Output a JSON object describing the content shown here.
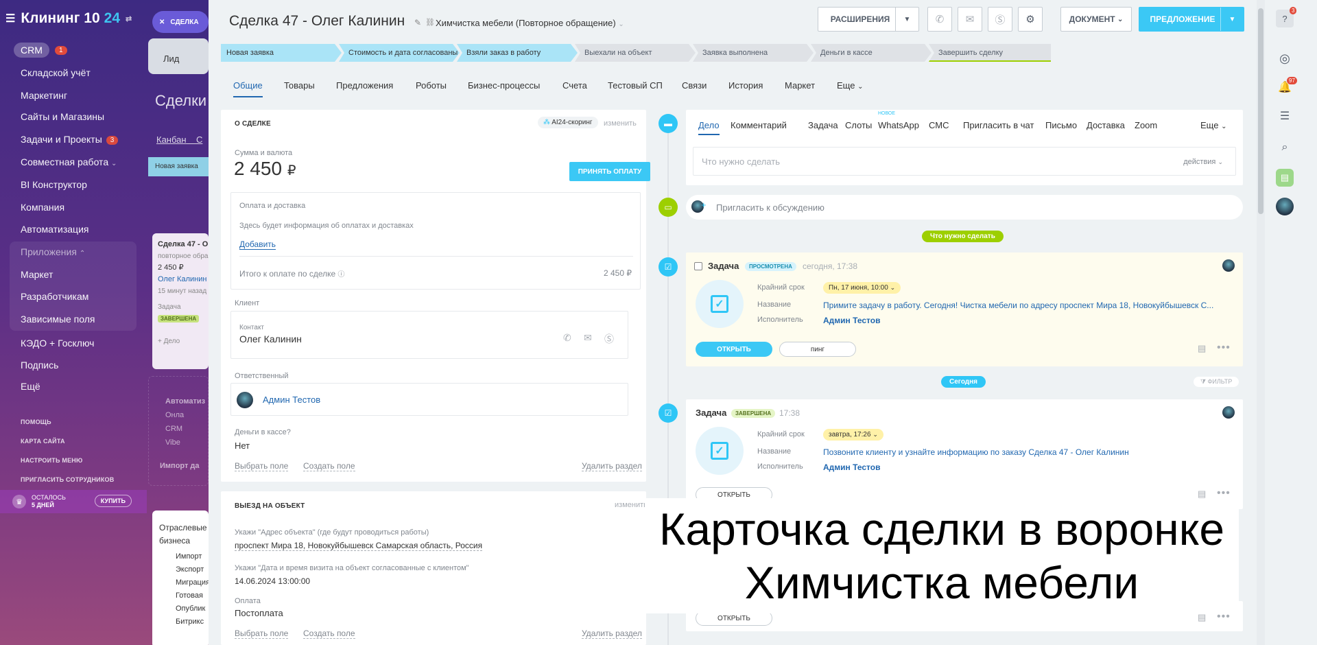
{
  "sidebar": {
    "logo_text": "Клининг 10",
    "logo_accent": "24",
    "crm_label": "CRM",
    "crm_badge": "1",
    "items": [
      {
        "label": "Складской учёт"
      },
      {
        "label": "Маркетинг"
      },
      {
        "label": "Сайты и Магазины"
      },
      {
        "label": "Задачи и Проекты",
        "badge": "3"
      },
      {
        "label": "Совместная работа"
      },
      {
        "label": "BI Конструктор"
      },
      {
        "label": "Компания"
      },
      {
        "label": "Автоматизация"
      },
      {
        "label": "Приложения"
      },
      {
        "label": "Маркет"
      },
      {
        "label": "Разработчикам"
      },
      {
        "label": "Зависимые поля"
      },
      {
        "label": "КЭДО + Госключ"
      },
      {
        "label": "Подпись"
      },
      {
        "label": "Ещё"
      }
    ],
    "links": [
      "ПОМОЩЬ",
      "КАРТА САЙТА",
      "НАСТРОИТЬ МЕНЮ",
      "ПРИГЛАСИТЬ СОТРУДНИКОВ"
    ],
    "trial_line1": "ОСТАЛОСЬ",
    "trial_line2": "5 ДНЕЙ",
    "buy_label": "КУПИТЬ"
  },
  "kanban": {
    "close_label": "СДЕЛКА",
    "lead_tab": "Лид",
    "title": "Сделки",
    "tab1": "Канбан",
    "tab2": "С",
    "column": "Новая заявка",
    "card_title": "Сделка 47 - О",
    "card_sub": "повторное обра",
    "card_sum": "2 450 ₽",
    "card_client": "Олег Калинин",
    "card_time": "15 минут назад",
    "card_task": "Задача",
    "card_status": "ЗАВЕРШЕНА",
    "card_add": "+ Дело",
    "auto_title": "Автоматиз",
    "auto_items": [
      "Онла",
      "CRM",
      "Vibe"
    ],
    "import_label": "Импорт да",
    "industry_title1": "Отраслевые",
    "industry_title2": "бизнеса",
    "industry_items": [
      "Импорт",
      "Экспорт",
      "Миграция",
      "Готовая",
      "Опублик Битрикс"
    ]
  },
  "header": {
    "deal_title": "Сделка 47 - Олег Калинин",
    "funnel": "Химчистка мебели (Повторное обращение)",
    "extensions": "РАСШИРЕНИЯ",
    "document": "ДОКУМЕНТ",
    "proposal": "ПРЕДЛОЖЕНИЕ"
  },
  "stages": [
    {
      "label": "Новая заявка",
      "state": "done"
    },
    {
      "label": "Стоимость и дата согласованы",
      "state": "done"
    },
    {
      "label": "Взяли заказ в работу",
      "state": "done"
    },
    {
      "label": "Выехали на объект",
      "state": "todo"
    },
    {
      "label": "Заявка выполнена",
      "state": "todo"
    },
    {
      "label": "Деньги в кассе",
      "state": "todo"
    },
    {
      "label": "Завершить сделку",
      "state": "final"
    }
  ],
  "tabs": [
    "Общие",
    "Товары",
    "Предложения",
    "Роботы",
    "Бизнес-процессы",
    "Счета",
    "Тестовый СП",
    "Связи",
    "История",
    "Маркет",
    "Еще"
  ],
  "about": {
    "title": "О СДЕЛКЕ",
    "ai_label": "AI24-скоринг",
    "edit": "изменить",
    "sum_label": "Сумма и валюта",
    "sum_value": "2 450",
    "currency": "₽",
    "accept_payment": "ПРИНЯТЬ ОПЛАТУ",
    "pay_label": "Оплата и доставка",
    "pay_hint": "Здесь будет информация об оплатах и доставках",
    "add": "Добавить",
    "total_label": "Итого к оплате по сделке",
    "total_value": "2 450 ₽",
    "client_label": "Клиент",
    "contact_label": "Контакт",
    "contact_name": "Олег Калинин",
    "responsible_label": "Ответственный",
    "responsible_name": "Админ Тестов",
    "cash_label": "Деньги в кассе?",
    "cash_value": "Нет",
    "select_field": "Выбрать поле",
    "create_field": "Создать поле",
    "delete_section": "Удалить раздел"
  },
  "visit": {
    "title": "ВЫЕЗД НА ОБЪЕКТ",
    "edit": "изменить",
    "address_label": "Укажи \"Адрес объекта\" (где будут проводиться работы)",
    "address_value": "проспект Мира 18, Новокуйбышевск Самарская область, Россия",
    "date_label": "Укажи \"Дата и время визита на объект согласованные с клиентом\"",
    "date_value": "14.06.2024 13:00:00",
    "payment_label": "Оплата",
    "payment_value": "Постоплата",
    "select_field": "Выбрать поле",
    "create_field": "Создать поле",
    "delete_section": "Удалить раздел"
  },
  "activity": {
    "tabs": [
      "Дело",
      "Комментарий",
      "Задача",
      "Слоты",
      "WhatsApp",
      "СМС",
      "Пригласить в чат",
      "Письмо",
      "Доставка",
      "Zoom",
      "Еще"
    ],
    "new_badge": "НОВОЕ",
    "input_placeholder": "Что нужно сделать",
    "actions": "действия",
    "invite": "Пригласить к обсуждению",
    "todo_pill": "Что нужно сделать",
    "today_pill": "Сегодня",
    "filter": "ФИЛЬТР"
  },
  "task1": {
    "title": "Задача",
    "status": "ПРОСМОТРЕНА",
    "time": "сегодня, 17:38",
    "deadline_label": "Крайний срок",
    "deadline": "Пн, 17 июня, 10:00",
    "name_label": "Название",
    "name": "Примите задачу в работу. Сегодня! Чистка мебели по адресу проспект Мира 18, Новокуйбышевск С...",
    "exec_label": "Исполнитель",
    "exec": "Админ Тестов",
    "open": "ОТКРЫТЬ",
    "ping": "пинг"
  },
  "task2": {
    "title": "Задача",
    "status": "ЗАВЕРШЕНА",
    "time": "17:38",
    "deadline_label": "Крайний срок",
    "deadline": "завтра, 17:26",
    "name_label": "Название",
    "name": "Позвоните клиенту и узнайте информацию по заказу Сделка 47 - Олег Калинин",
    "exec_label": "Исполнитель",
    "exec": "Админ Тестов",
    "open": "ОТКРЫТЬ"
  },
  "task3": {
    "open": "ОТКРЫТЬ"
  },
  "overlay": {
    "line1": "Карточка сделки в воронке",
    "line2": "Химчистка мебели"
  },
  "rail": {
    "help_badge": "3",
    "notif_badge": "97"
  },
  "colors": {
    "accent": "#3bc8f5",
    "link": "#2067b0",
    "green": "#9dcf00",
    "stage_done": "#aae4f7"
  }
}
